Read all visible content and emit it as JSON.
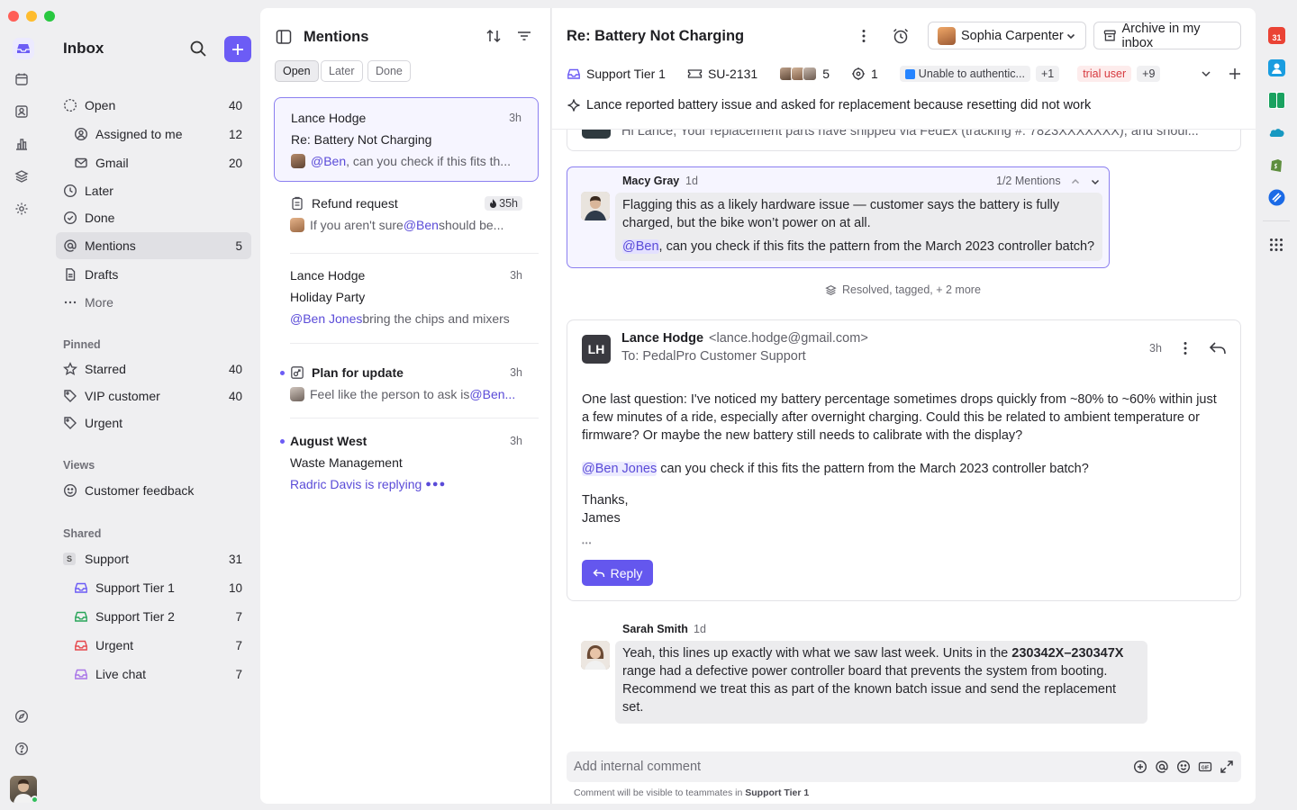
{
  "sidebar": {
    "title": "Inbox",
    "nav": [
      {
        "label": "Open",
        "count": "40"
      },
      {
        "label": "Assigned to me",
        "count": "12"
      },
      {
        "label": "Gmail",
        "count": "20"
      },
      {
        "label": "Later",
        "count": ""
      },
      {
        "label": "Done",
        "count": ""
      },
      {
        "label": "Mentions",
        "count": "5"
      },
      {
        "label": "Drafts",
        "count": ""
      },
      {
        "label": "More",
        "count": ""
      }
    ],
    "pinned_header": "Pinned",
    "pinned": [
      {
        "label": "Starred",
        "count": "40"
      },
      {
        "label": "VIP customer",
        "count": "40"
      },
      {
        "label": "Urgent",
        "count": ""
      }
    ],
    "views_header": "Views",
    "views": [
      {
        "label": "Customer feedback"
      }
    ],
    "shared_header": "Shared",
    "shared": [
      {
        "label": "Support",
        "count": "31",
        "badge": "S"
      },
      {
        "label": "Support Tier 1",
        "count": "10",
        "color": "#6c5cf5"
      },
      {
        "label": "Support Tier 2",
        "count": "7",
        "color": "#2aa55a"
      },
      {
        "label": "Urgent",
        "count": "7",
        "color": "#e5484d"
      },
      {
        "label": "Live chat",
        "count": "7",
        "color": "#a874e8"
      }
    ]
  },
  "list": {
    "title": "Mentions",
    "tabs": [
      "Open",
      "Later",
      "Done"
    ],
    "items": [
      {
        "sender": "Lance Hodge",
        "time": "3h",
        "subject": "Re: Battery Not Charging",
        "mention": "@Ben",
        "preview": ", can you check if this fits th..."
      },
      {
        "subject": "Refund request",
        "time": "35h",
        "pre": "If you aren't sure ",
        "mention": "@Ben",
        "preview": " should be..."
      },
      {
        "sender": "Lance Hodge",
        "time": "3h",
        "subject": "Holiday Party",
        "mention": "@Ben Jones",
        "preview": " bring the chips and mixers"
      },
      {
        "subject": "Plan for update",
        "time": "3h",
        "pre": "Feel like the person to ask is ",
        "mention": "@Ben..."
      },
      {
        "sender": "August West",
        "time": "3h",
        "subject": "Waste Management",
        "typing": "Radric Davis is replying"
      }
    ]
  },
  "conversation": {
    "title": "Re: Battery Not Charging",
    "assignee": "Sophia Carpenter",
    "archive_label": "Archive in my inbox",
    "inbox": "Support Tier 1",
    "ticket": "SU-2131",
    "participants_count": "5",
    "watchers_count": "1",
    "integration_tag": "Unable to authentic...",
    "integration_more": "+1",
    "tag": "trial user",
    "tag_more": "+9",
    "summary": "Lance reported battery issue and asked for replacement because resetting did not work",
    "truncated_prev": "Hi Lance, Your replacement parts have shipped via FedEx (tracking #: 7823XXXXXXX), and shoul...",
    "comment1": {
      "author": "Macy Gray",
      "time": "1d",
      "mentions_nav": "1/2 Mentions",
      "line1": "Flagging this as a likely hardware issue — customer says the battery is fully",
      "line2": "charged, but the bike won’t power on at all.",
      "mention": "@Ben",
      "line3": ", can you check if this fits the pattern from the March 2023 controller batch?"
    },
    "activity": "Resolved, tagged, + 2 more",
    "email": {
      "initials": "LH",
      "from_name": "Lance Hodge",
      "from_email": "<lance.hodge@gmail.com>",
      "to": "To: PedalPro Customer Support",
      "time": "3h",
      "p1": "One last question: I've noticed my battery percentage sometimes drops quickly from ~80% to ~60% within just",
      "p2": "a few minutes of a ride, especially after overnight charging. Could this be related to ambient temperature or",
      "p3": "firmware? Or maybe the new battery still needs to calibrate with the display?",
      "mention": "@Ben Jones",
      "mention_rest": " can you check if this fits the pattern from the March 2023 controller batch?",
      "thanks": "Thanks,",
      "signoff": "James",
      "more": "•••",
      "reply_label": "Reply"
    },
    "comment2": {
      "author": "Sarah Smith",
      "time": "1d",
      "l1a": "Yeah, this lines up exactly with what we saw last week. Units in the ",
      "l1b": "230342X–230347X",
      "l2": "range had a defective power controller board that prevents the system from booting.",
      "l3": "Recommend we treat this as part of the known batch issue and send the replacement",
      "l4": "set."
    },
    "composer_placeholder": "Add internal comment",
    "composer_hint_pre": "Comment will be visible to teammates in ",
    "composer_hint_inbox": "Support Tier 1"
  },
  "colors": {
    "accent": "#6c5cf5",
    "mention": "#5a4bd8",
    "tag_red": "#e5484d"
  }
}
